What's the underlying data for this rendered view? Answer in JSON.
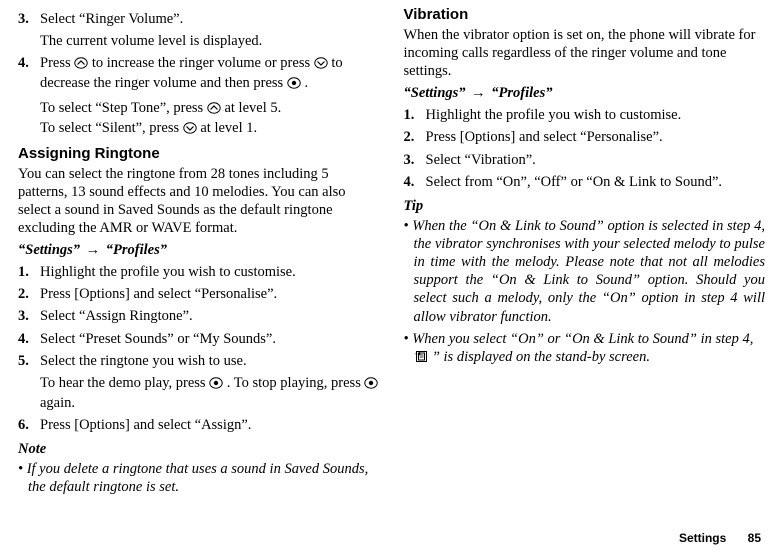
{
  "left": {
    "steps_a": [
      {
        "num": "3.",
        "text": "Select “Ringer Volume”."
      },
      {
        "num": "",
        "text": "The current volume level is displayed."
      },
      {
        "num": "4.",
        "pre": "Press ",
        "icon1": "up",
        "mid": " to increase the ringer volume or press ",
        "icon2": "down",
        "post1": " to decrease the ringer volume and then press ",
        "icon3": "center",
        "post2": "."
      }
    ],
    "steps_a_tail1_pre": "To select “Step Tone”, press ",
    "steps_a_tail1_post": " at level 5.",
    "steps_a_tail2_pre": "To select “Silent”, press ",
    "steps_a_tail2_post": " at level 1.",
    "heading1": "Assigning Ringtone",
    "intro1": "You can select the ringtone from 28 tones including 5 patterns, 13 sound effects and 10 melodies. You can also select a sound in Saved Sounds as the default ringtone excluding the AMR or WAVE format.",
    "path_a": "“Settings”",
    "path_b": "“Profiles”",
    "steps_b": [
      {
        "num": "1.",
        "text": "Highlight the profile you wish to customise."
      },
      {
        "num": "2.",
        "text": "Press [Options] and select “Personalise”."
      },
      {
        "num": "3.",
        "text": "Select “Assign Ringtone”."
      },
      {
        "num": "4.",
        "text": "Select “Preset Sounds” or “My Sounds”."
      },
      {
        "num": "5.",
        "text": "Select the ringtone you wish to use."
      }
    ],
    "steps_b_tail_pre": "To hear the demo play, press ",
    "steps_b_tail_mid": ". To stop playing, press ",
    "steps_b_tail_post": " again.",
    "steps_b6_num": "6.",
    "steps_b6_text": "Press [Options] and select “Assign”.",
    "note_label": "Note",
    "note_body": "• If you delete a ringtone that uses a sound in Saved Sounds, the default ringtone is set."
  },
  "right": {
    "heading": "Vibration",
    "intro": "When the vibrator option is set on, the phone will vibrate for incoming calls regardless of the ringer volume and tone settings.",
    "path_a": "“Settings”",
    "path_b": "“Profiles”",
    "steps": [
      {
        "num": "1.",
        "text": "Highlight the profile you wish to customise."
      },
      {
        "num": "2.",
        "text": "Press [Options] and select “Personalise”."
      },
      {
        "num": "3.",
        "text": "Select “Vibration”."
      },
      {
        "num": "4.",
        "text": "Select from “On”, “Off” or “On & Link to Sound”."
      }
    ],
    "tip_label": "Tip",
    "tip1": "• When the “On & Link to Sound” option is selected in step 4, the vibrator synchronises with your selected melody to pulse in time with the melody. Please note that not all melodies support the “On & Link to Sound” option. Should you select such a melody, only the “On” option in step 4 will allow vibrator function.",
    "tip2_pre": "• When you select “On” or “On & Link to Sound” in step 4, “",
    "tip2_post": "” is displayed on the stand-by screen."
  },
  "footer": {
    "section": "Settings",
    "page": "85"
  }
}
